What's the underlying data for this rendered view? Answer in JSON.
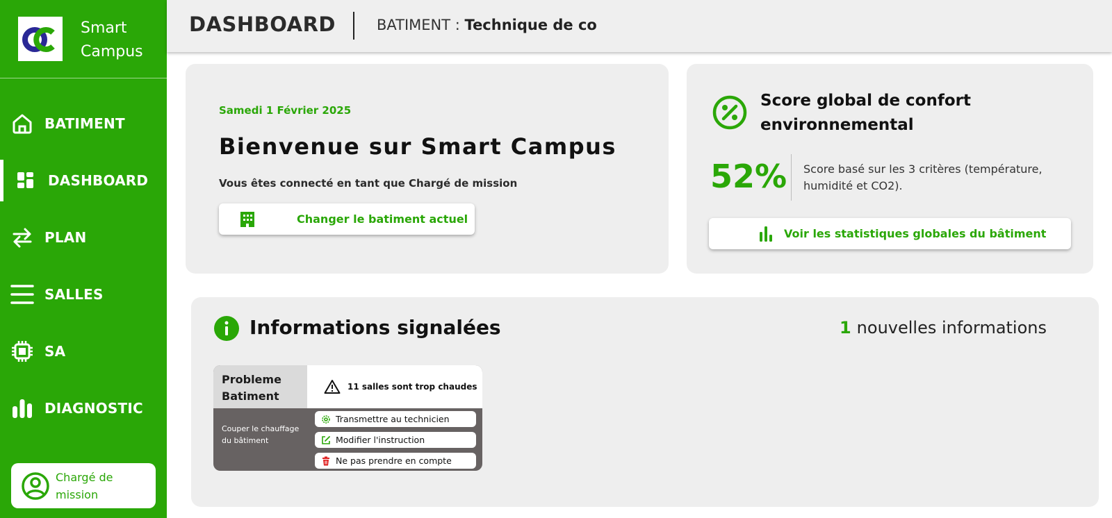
{
  "sidebar": {
    "brand": {
      "name": "Smart Campus"
    },
    "items": [
      {
        "label": "BATIMENT",
        "icon": "home-icon",
        "active": false
      },
      {
        "label": "DASHBOARD",
        "icon": "dashboard-icon",
        "active": true
      },
      {
        "label": "PLAN",
        "icon": "swap-arrows-icon",
        "active": false
      },
      {
        "label": "SALLES",
        "icon": "list-icon",
        "active": false
      },
      {
        "label": "SA",
        "icon": "chip-icon",
        "active": false
      },
      {
        "label": "DIAGNOSTIC",
        "icon": "bar-chart-icon",
        "active": false
      }
    ],
    "user": {
      "label": "Chargé de mission",
      "icon": "user-circle-icon"
    }
  },
  "header": {
    "title": "DASHBOARD",
    "building_prefix": "BATIMENT :",
    "building_name": "Technique de co"
  },
  "welcome": {
    "date": "Samedi 1 Février 2025",
    "title": "Bienvenue sur Smart Campus",
    "role": "Vous êtes connecté en tant que Chargé de mission",
    "change_button": "Changer le batiment actuel"
  },
  "score": {
    "title": "Score global de confort environnemental",
    "value": "52%",
    "description": "Score basé sur les 3 critères (température, humidité et CO2).",
    "stats_button": "Voir les statistiques globales du bâtiment"
  },
  "info": {
    "title": "Informations signalées",
    "count": "1",
    "count_label": "nouvelles informations",
    "problem": {
      "category": "Probleme Batiment",
      "warning": "11 salles sont trop chaudes",
      "instruction": "Couper le chauffage du bâtiment",
      "actions": [
        {
          "label": "Transmettre au technicien",
          "icon": "gear-icon"
        },
        {
          "label": "Modifier l'instruction",
          "icon": "edit-icon"
        },
        {
          "label": "Ne pas prendre en compte",
          "icon": "trash-icon"
        }
      ]
    }
  },
  "colors": {
    "primary": "#2aa707",
    "danger": "#e02020",
    "card_bg": "#eeeeee",
    "problem_bg": "#676262"
  }
}
